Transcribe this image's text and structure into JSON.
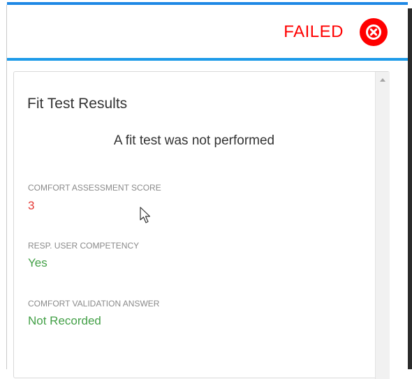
{
  "header": {
    "status": "FAILED",
    "status_icon": "close-circle-icon",
    "status_color": "#ff0000",
    "accent_color": "#1e88e5"
  },
  "card": {
    "title": "Fit Test Results",
    "message": "A fit test was not performed",
    "fields": [
      {
        "label": "COMFORT ASSESSMENT SCORE",
        "value": "3",
        "value_color": "#e53935"
      },
      {
        "label": "RESP. USER COMPETENCY",
        "value": "Yes",
        "value_color": "#43a047"
      },
      {
        "label": "COMFORT VALIDATION ANSWER",
        "value": "Not Recorded",
        "value_color": "#43a047"
      }
    ]
  }
}
